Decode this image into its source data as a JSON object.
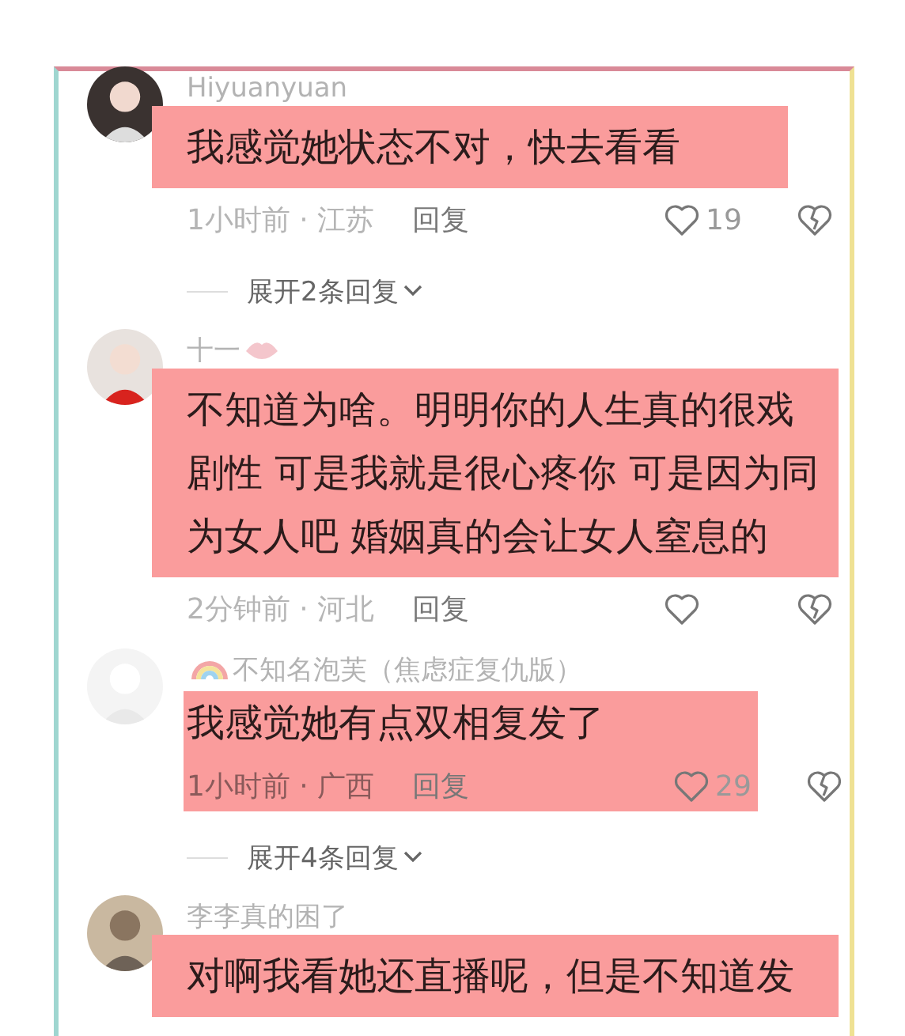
{
  "comments": [
    {
      "author": "Hiyuanyuan",
      "text": "我感觉她状态不对，快去看看",
      "highlighted": true,
      "meta_highlighted": false,
      "time_place": "1小时前 · 江苏",
      "reply": "回复",
      "likes": "19",
      "expand": "展开2条回复"
    },
    {
      "author": "十一",
      "name_icon": {
        "kind": "lips"
      },
      "text": "不知道为啥。明明你的人生真的很戏剧性 可是我就是很心疼你 可是因为同为女人吧 婚姻真的会让女人窒息的",
      "highlighted": true,
      "meta_highlighted": false,
      "time_place": "2分钟前 · 河北",
      "reply": "回复"
    },
    {
      "author": "不知名泡芙（焦虑症复仇版）",
      "name_icon": {
        "kind": "rainbow"
      },
      "text": "我感觉她有点双相复发了",
      "highlighted": true,
      "meta_highlighted": true,
      "time_place": "1小时前 · 广西",
      "reply": "回复",
      "likes": "29",
      "expand": "展开4条回复"
    },
    {
      "author": "李李真的困了",
      "text": "对啊我看她还直播呢，但是不知道发",
      "highlighted": true,
      "meta_highlighted": false
    }
  ]
}
